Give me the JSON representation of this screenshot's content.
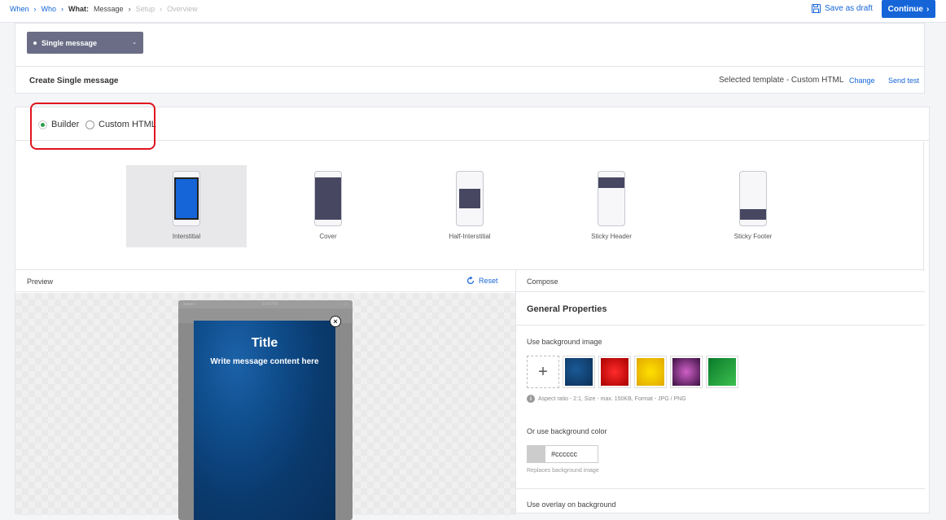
{
  "breadcrumb": {
    "when": "When",
    "who": "Who",
    "what": "What:",
    "what_value": "Message",
    "setup": "Setup",
    "overview": "Overview"
  },
  "header": {
    "save_draft": "Save as draft",
    "continue": "Continue"
  },
  "message_type": {
    "selected": "Single message"
  },
  "create": {
    "title": "Create Single message",
    "selected_template": "Selected template - Custom HTML",
    "change": "Change",
    "send_test": "Send test"
  },
  "editor_mode": {
    "options": [
      "Builder",
      "Custom HTML"
    ],
    "selected": "Builder"
  },
  "layouts": [
    {
      "label": "Interstitial",
      "selected": true
    },
    {
      "label": "Cover",
      "selected": false
    },
    {
      "label": "Half-Interstitial",
      "selected": false
    },
    {
      "label": "Sticky Header",
      "selected": false
    },
    {
      "label": "Sticky Footer",
      "selected": false
    }
  ],
  "preview": {
    "label": "Preview",
    "reset": "Reset",
    "status_time": "3:00 PM",
    "status_carrier": "●●●●○",
    "message_title": "Title",
    "message_body": "Write message content here",
    "close_glyph": "×"
  },
  "compose": {
    "label": "Compose",
    "general_properties": "General Properties",
    "bg_image_label": "Use background image",
    "add_glyph": "+",
    "bg_image_hint": "Aspect ratio - 2:1, Size - max. 150KB, Format - JPG / PNG",
    "hint_icon": "i",
    "bg_color_label": "Or use background color",
    "bg_color_value": "#cccccc",
    "bg_color_hint": "Replaces background image",
    "overlay_label": "Use overlay on background"
  },
  "colors": {
    "accent": "#1565d8",
    "highlight": "#e0141e",
    "selected_radio": "#2e9e4e",
    "phone_fill_active": "#1565d8",
    "phone_fill": "#474762"
  }
}
